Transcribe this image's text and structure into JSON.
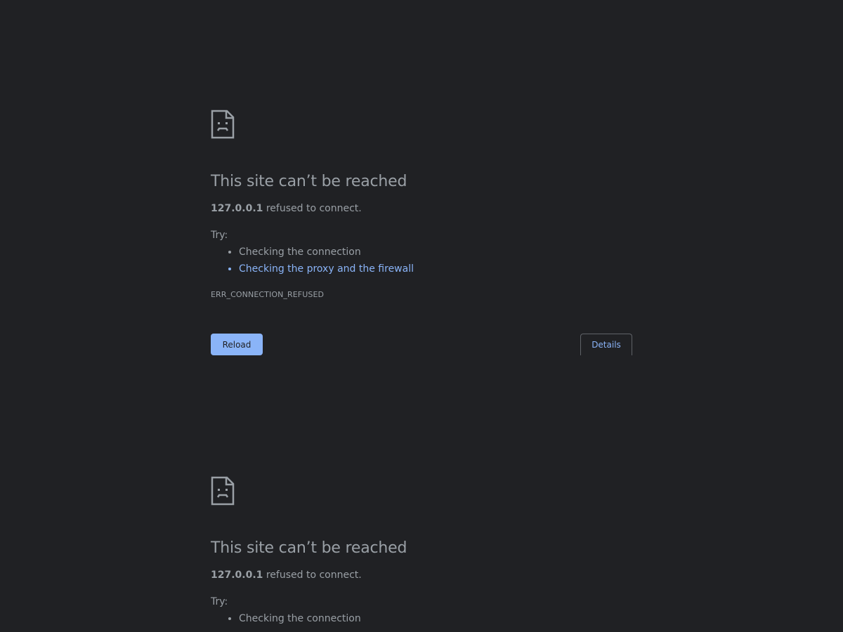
{
  "colors": {
    "background": "#202124",
    "text": "#9aa0a6",
    "link": "#8ab4f8",
    "button_bg": "#8ab4f8"
  },
  "error_pages": [
    {
      "icon": "sad-file-icon",
      "title": "This site can’t be reached",
      "host": "127.0.0.1",
      "message": " refused to connect.",
      "try_label": "Try:",
      "suggestions": [
        "Checking the connection",
        "Checking the proxy and the firewall"
      ],
      "error_code": "ERR_CONNECTION_REFUSED",
      "reload_label": "Reload",
      "details_label": "Details"
    },
    {
      "icon": "sad-file-icon",
      "title": "This site can’t be reached",
      "host": "127.0.0.1",
      "message": " refused to connect.",
      "try_label": "Try:",
      "suggestions": [
        "Checking the connection"
      ]
    }
  ]
}
